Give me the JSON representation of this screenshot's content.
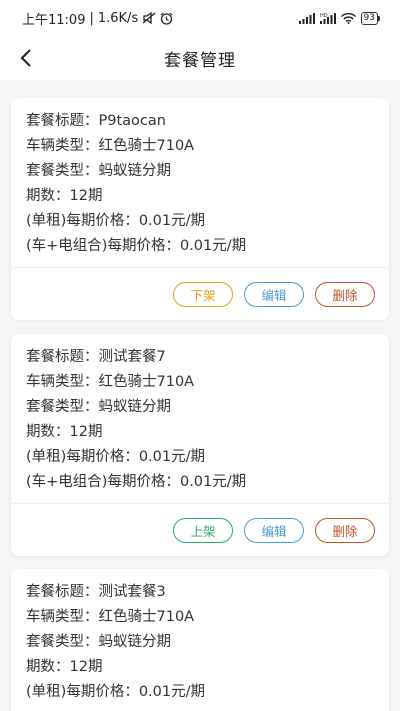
{
  "status_bar": {
    "time": "上午11:09",
    "net_speed": "1.6K/s",
    "battery": "93",
    "icons": [
      "mute-icon",
      "alarm-icon",
      "signal-icon",
      "hd-signal-icon",
      "wifi-icon",
      "battery-icon"
    ]
  },
  "nav": {
    "back_icon": "chevron-left-icon",
    "title": "套餐管理"
  },
  "packages": [
    {
      "title": "套餐标题：P9taocan",
      "vehicle": "车辆类型：红色骑士710A",
      "plan_type": "套餐类型：蚂蚁链分期",
      "periods": "期数：12期",
      "single_price": "(单租)每期价格：0.01元/期",
      "combo_price": "(车+电组合)每期价格：0.01元/期",
      "shelf_label": "下架",
      "shelf_color": "#e0a11b",
      "edit_label": "编辑",
      "delete_label": "删除"
    },
    {
      "title": "套餐标题：测试套餐7",
      "vehicle": "车辆类型：红色骑士710A",
      "plan_type": "套餐类型：蚂蚁链分期",
      "periods": "期数：12期",
      "single_price": "(单租)每期价格：0.01元/期",
      "combo_price": "(车+电组合)每期价格：0.01元/期",
      "shelf_label": "上架",
      "shelf_color": "#2bab6e",
      "edit_label": "编辑",
      "delete_label": "删除"
    },
    {
      "title": "套餐标题：测试套餐3",
      "vehicle": "车辆类型：红色骑士710A",
      "plan_type": "套餐类型：蚂蚁链分期",
      "periods": "期数：12期",
      "single_price": "(单租)每期价格：0.01元/期"
    }
  ],
  "colors": {
    "edit": "#4a9bd6",
    "delete": "#c0532a",
    "background": "#f5f5f5"
  }
}
